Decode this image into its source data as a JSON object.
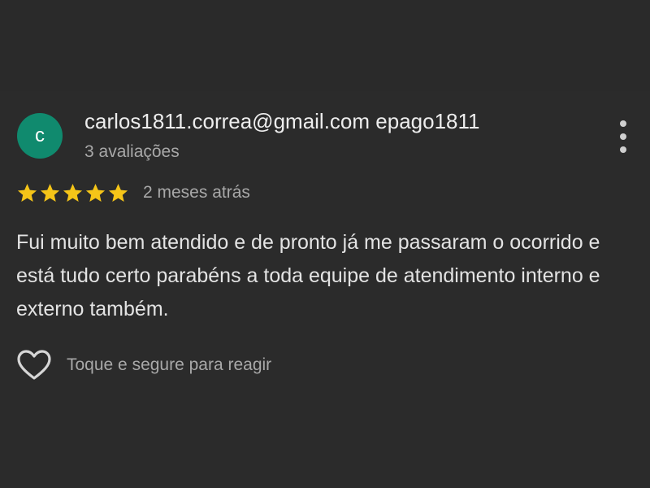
{
  "colors": {
    "background": "#2a2a2a",
    "avatar_bg": "#108a6e",
    "star": "#f5c518",
    "primary_text": "#e6e6e6",
    "secondary_text": "#a8a8a8"
  },
  "review": {
    "author": {
      "avatar_initial": "c",
      "name": "carlos1811.correa@gmail.com epago1811",
      "meta": "3 avaliações"
    },
    "menu_icon": "more-vertical-icon",
    "rating": 5,
    "rating_max": 5,
    "star_icon": "star-icon",
    "date": "2 meses atrás",
    "text": "Fui muito bem atendido e de pronto já me passaram o ocorrido e está tudo certo parabéns a toda equipe de atendimento interno e externo também.",
    "reaction": {
      "icon": "heart-outline-icon",
      "hint": "Toque e segure para reagir"
    }
  }
}
